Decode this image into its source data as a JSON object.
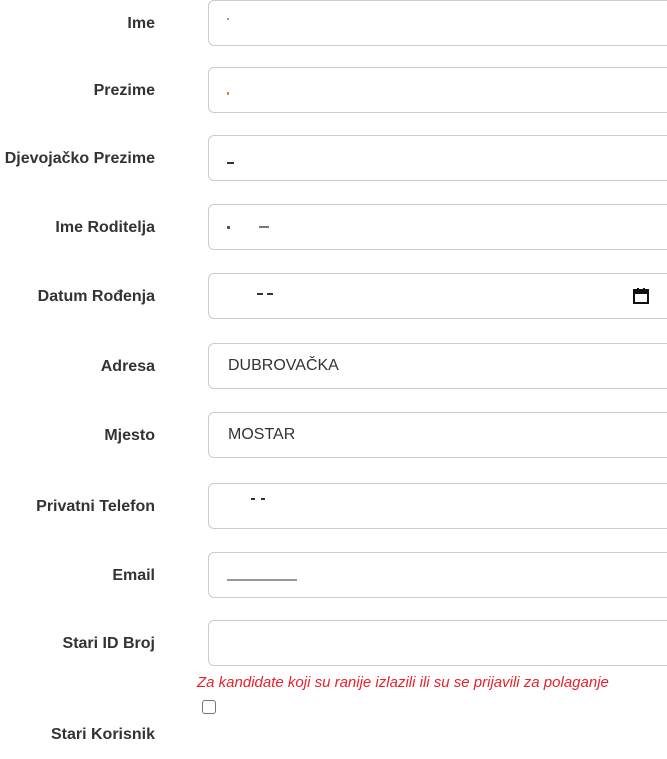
{
  "form": {
    "fields": [
      {
        "label": "Ime",
        "value": ""
      },
      {
        "label": "Prezime",
        "value": ""
      },
      {
        "label": "Djevojačko Prezime",
        "value": ""
      },
      {
        "label": "Ime Roditelja",
        "value": ""
      },
      {
        "label": "Datum Rođenja",
        "value": ""
      },
      {
        "label": "Adresa",
        "value": "DUBROVAČKA"
      },
      {
        "label": "Mjesto",
        "value": "MOSTAR"
      },
      {
        "label": "Privatni Telefon",
        "value": ""
      },
      {
        "label": "Email",
        "value": ""
      },
      {
        "label": "Stari ID Broj",
        "value": ""
      }
    ],
    "old_id_help": "Za kandidate koji su ranije izlazili ili su se prijavili za polaganje",
    "old_user": {
      "label": "Stari Korisnik",
      "checked": false
    }
  }
}
